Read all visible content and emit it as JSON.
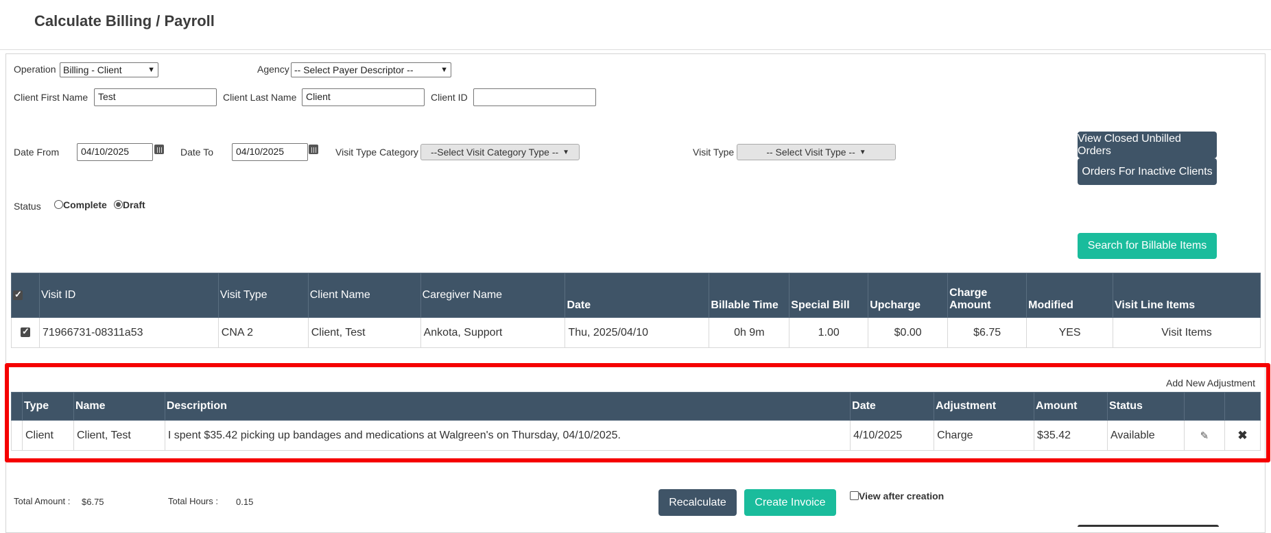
{
  "page": {
    "title": "Calculate Billing / Payroll"
  },
  "filters": {
    "operation_label": "Operation",
    "operation_value": "Billing - Client",
    "agency_label": "Agency",
    "agency_value": "-- Select Payer Descriptor --",
    "client_first_label": "Client First Name",
    "client_first_value": "Test",
    "client_last_label": "Client Last Name",
    "client_last_value": "Client",
    "client_id_label": "Client ID",
    "client_id_value": "",
    "date_from_label": "Date From",
    "date_from_value": "04/10/2025",
    "date_to_label": "Date To",
    "date_to_value": "04/10/2025",
    "visit_cat_label": "Visit Type Category",
    "visit_cat_value": "--Select Visit Category Type --",
    "visit_type_label": "Visit Type",
    "visit_type_value": "-- Select Visit Type --",
    "status_label": "Status",
    "status_complete": "Complete",
    "status_draft": "Draft",
    "status_selected": "Draft"
  },
  "buttons": {
    "view_closed": "View Closed Unbilled Orders",
    "inactive_clients": "Orders For Inactive Clients",
    "search": "Search for Billable Items",
    "recalculate": "Recalculate",
    "create_invoice": "Create Invoice",
    "view_after_creation": "View after creation"
  },
  "visits_table": {
    "headers": [
      "Visit ID",
      "Visit Type",
      "Client Name",
      "Caregiver Name",
      "Date",
      "Billable Time",
      "Special Bill",
      "Upcharge",
      "Charge Amount",
      "Modified",
      "Visit Line Items"
    ],
    "rows": [
      [
        "71966731-08311a53",
        "CNA 2",
        "Client, Test",
        "Ankota, Support",
        "Thu, 2025/04/10",
        "0h 9m",
        "1.00",
        "$0.00",
        "$6.75",
        "YES",
        "Visit Items"
      ]
    ]
  },
  "adjustments": {
    "add_link": "Add New Adjustment",
    "headers": [
      "Type",
      "Name",
      "Description",
      "Date",
      "Adjustment",
      "Amount",
      "Status"
    ],
    "rows": [
      [
        "Client",
        "Client, Test",
        "I spent $35.42 picking up bandages and medications at Walgreen's on Thursday, 04/10/2025.",
        "4/10/2025",
        "Charge",
        "$35.42",
        "Available"
      ]
    ]
  },
  "totals": {
    "amount_label": "Total Amount :",
    "amount_value": "$6.75",
    "hours_label": "Total Hours :",
    "hours_value": "0.15"
  },
  "colors": {
    "header_bg": "#3f5467",
    "accent_green": "#1abc9c",
    "highlight_red": "#f50000"
  }
}
